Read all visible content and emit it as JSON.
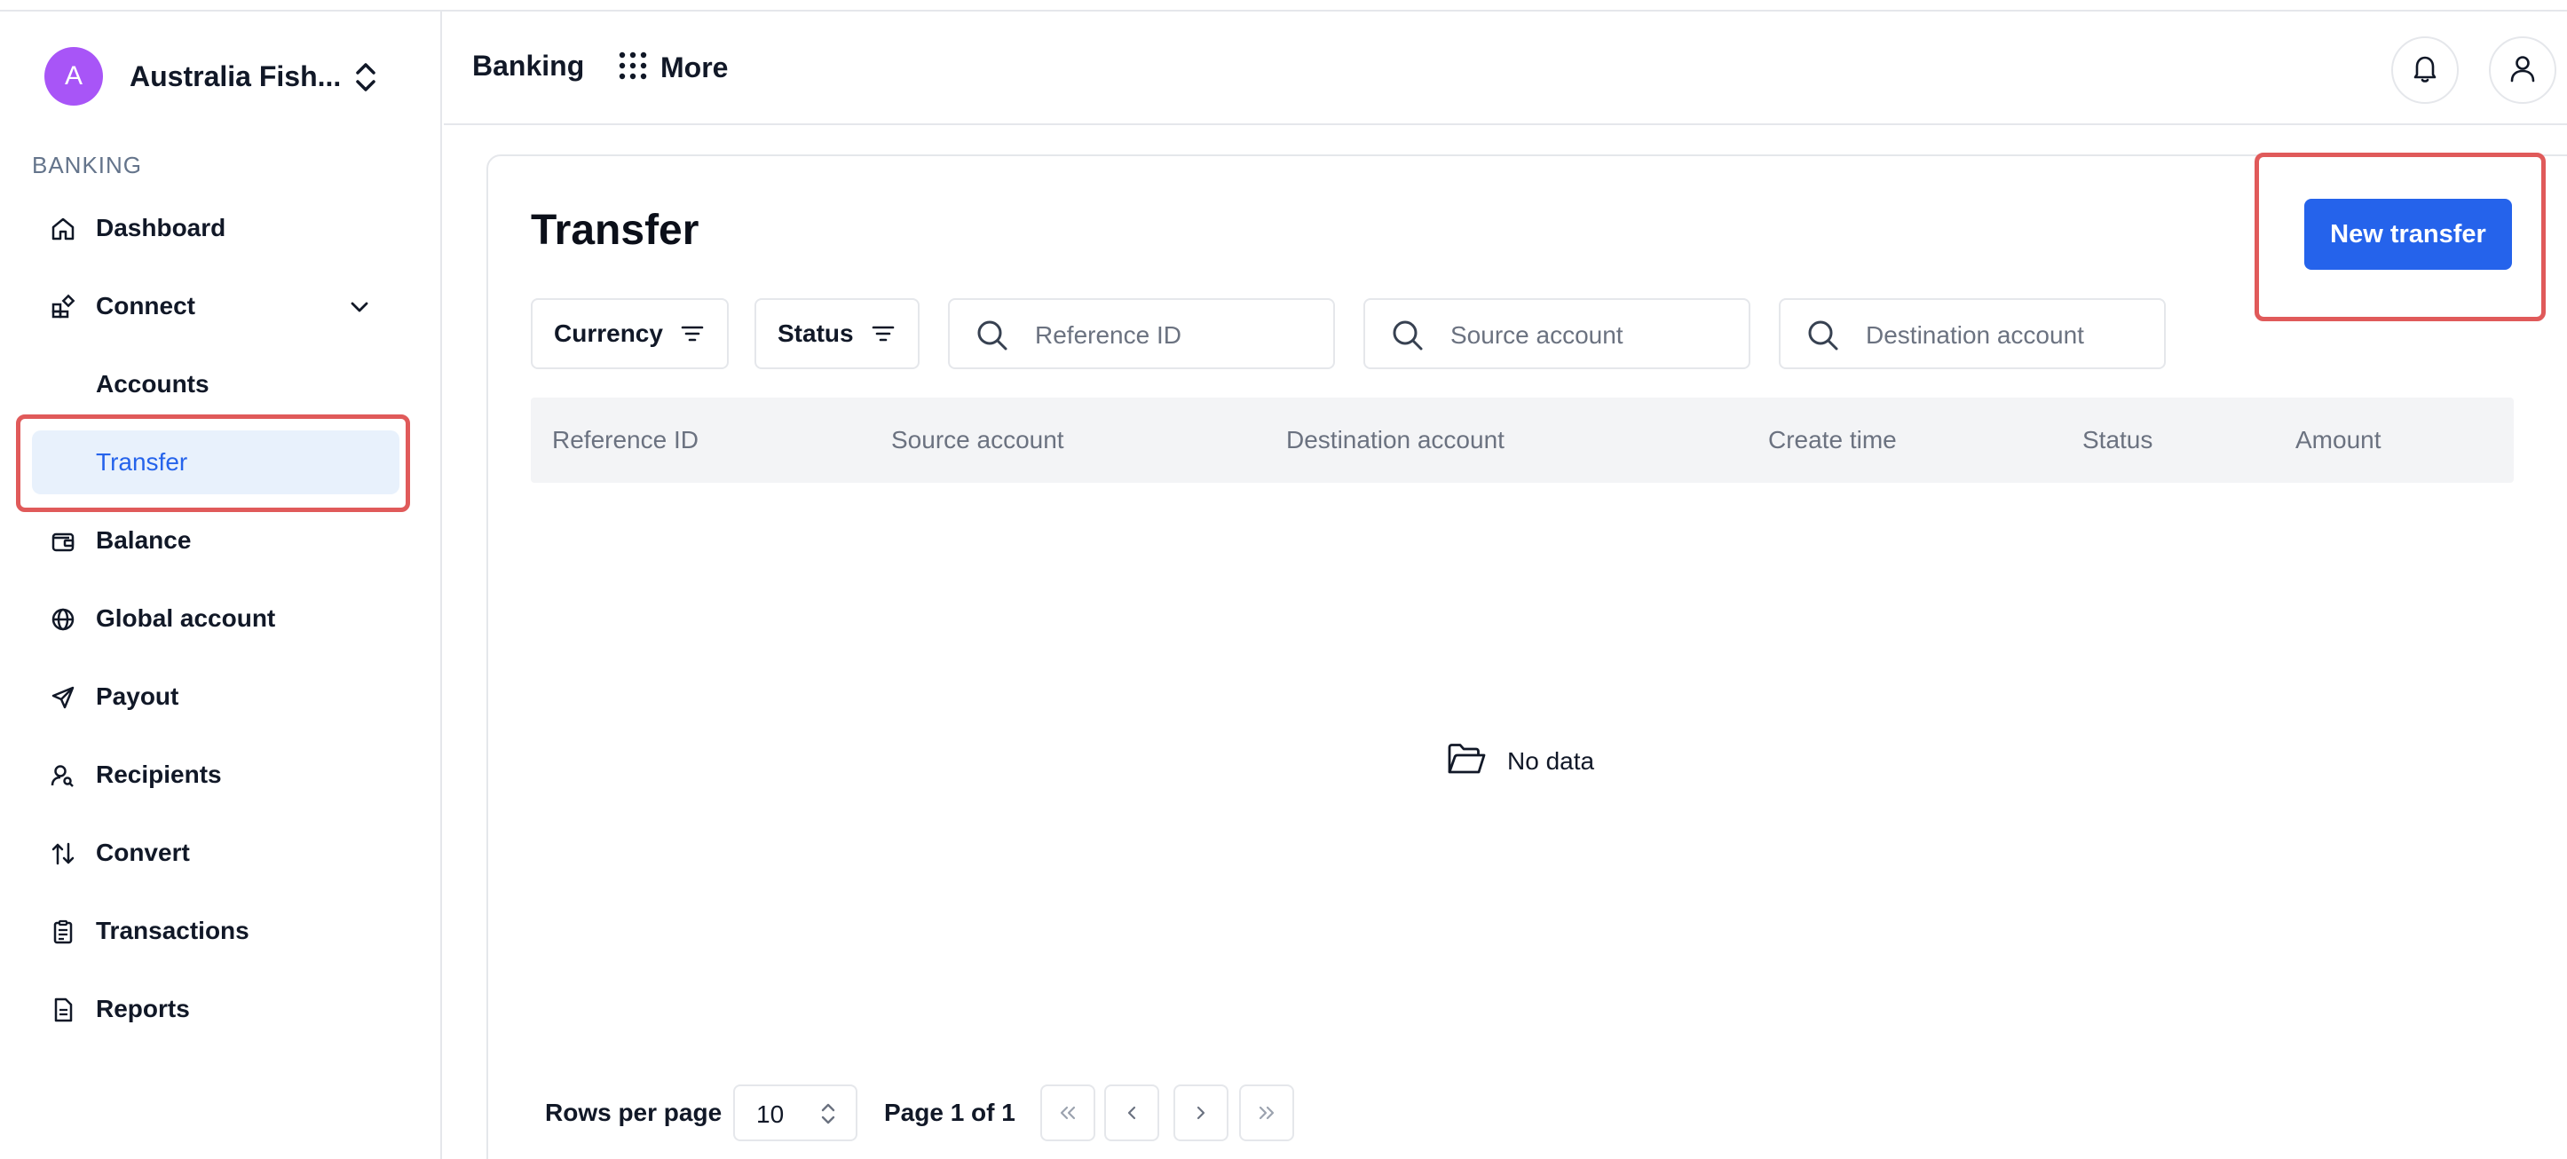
{
  "org": {
    "avatar_letter": "A",
    "name": "Australia Fish..."
  },
  "sidebar": {
    "section_label": "BANKING",
    "items": [
      {
        "label": "Dashboard",
        "icon": "home-icon"
      },
      {
        "label": "Connect",
        "icon": "connect-icon"
      },
      {
        "label": "Accounts",
        "icon": ""
      },
      {
        "label": "Transfer",
        "icon": ""
      },
      {
        "label": "Balance",
        "icon": "wallet-icon"
      },
      {
        "label": "Global account",
        "icon": "globe-icon"
      },
      {
        "label": "Payout",
        "icon": "send-icon"
      },
      {
        "label": "Recipients",
        "icon": "user-search-icon"
      },
      {
        "label": "Convert",
        "icon": "arrows-up-down-icon"
      },
      {
        "label": "Transactions",
        "icon": "clipboard-icon"
      },
      {
        "label": "Reports",
        "icon": "document-icon"
      }
    ]
  },
  "header": {
    "banking": "Banking",
    "more": "More"
  },
  "main": {
    "title": "Transfer",
    "new_transfer": "New transfer",
    "filters": {
      "currency": "Currency",
      "status": "Status"
    },
    "search": {
      "reference_placeholder": "Reference ID",
      "source_placeholder": "Source account",
      "destination_placeholder": "Destination account"
    },
    "table": {
      "columns": [
        "Reference ID",
        "Source account",
        "Destination account",
        "Create time",
        "Status",
        "Amount"
      ],
      "empty_text": "No data"
    },
    "pagination": {
      "rows_per_page_label": "Rows per page",
      "rows_per_page_value": "10",
      "page_label": "Page 1 of 1"
    }
  },
  "colors": {
    "primary": "#2563eb",
    "avatar": "#a855f7",
    "active_bg": "#e8f1fc",
    "highlight": "#e05a5a"
  }
}
